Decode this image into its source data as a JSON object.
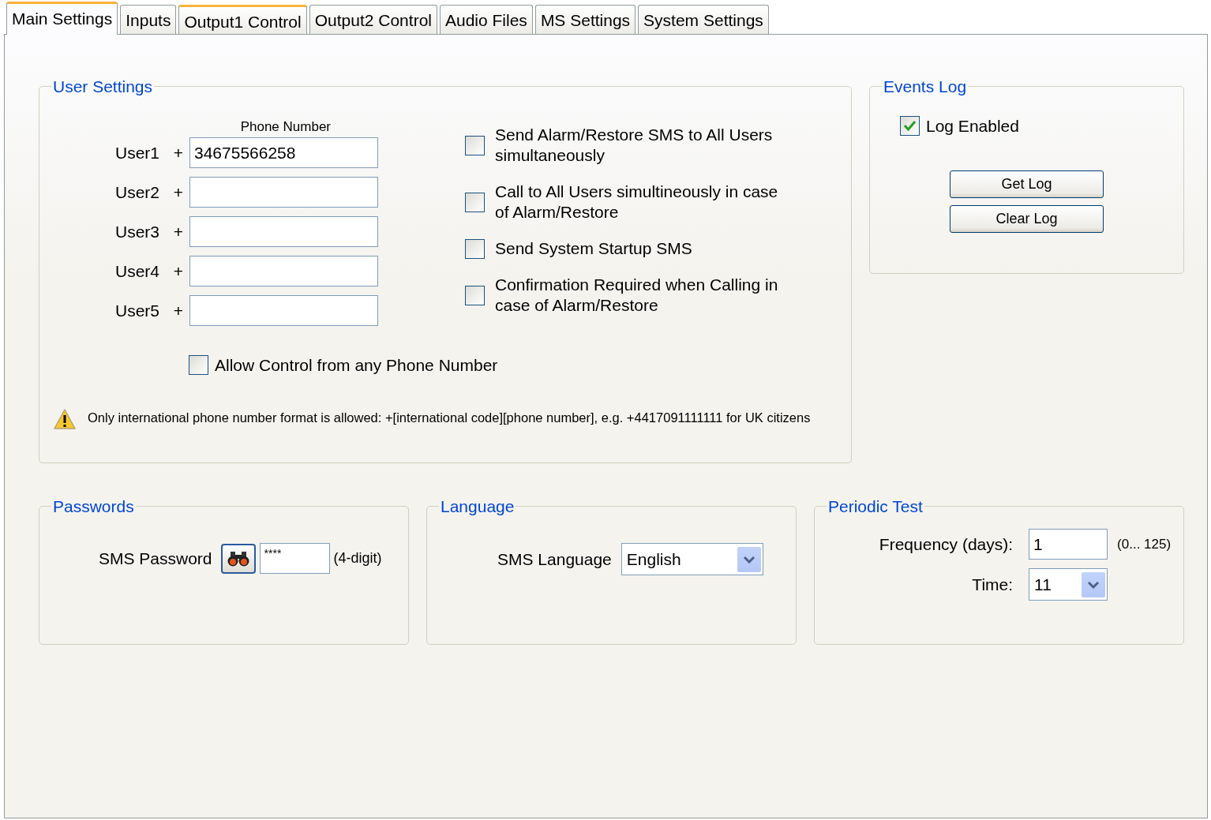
{
  "tabs": [
    {
      "label": "Main Settings",
      "selected": true,
      "hovered": false
    },
    {
      "label": "Inputs",
      "selected": false,
      "hovered": false
    },
    {
      "label": "Output1 Control",
      "selected": false,
      "hovered": true
    },
    {
      "label": "Output2 Control",
      "selected": false,
      "hovered": false
    },
    {
      "label": "Audio Files",
      "selected": false,
      "hovered": false
    },
    {
      "label": "MS Settings",
      "selected": false,
      "hovered": false
    },
    {
      "label": "System Settings",
      "selected": false,
      "hovered": false
    }
  ],
  "user_settings": {
    "title": "User Settings",
    "phone_column_label": "Phone Number",
    "users": [
      {
        "label": "User1",
        "prefix": "+",
        "value": "34675566258"
      },
      {
        "label": "User2",
        "prefix": "+"
      },
      {
        "label": "User3",
        "prefix": "+"
      },
      {
        "label": "User4",
        "prefix": "+"
      },
      {
        "label": "User5",
        "prefix": "+"
      }
    ],
    "options": [
      {
        "label": "Send Alarm/Restore SMS to All Users simultaneously",
        "checked": false
      },
      {
        "label": "Call to All Users simultineously in case of Alarm/Restore",
        "checked": false
      },
      {
        "label": "Send System Startup SMS",
        "checked": false
      },
      {
        "label": "Confirmation Required when Calling in case of Alarm/Restore",
        "checked": false
      }
    ],
    "allow_any": {
      "label": "Allow Control from any Phone Number",
      "checked": false
    },
    "note": "Only international phone number format is allowed: +[international code][phone number], e.g. +4417091111111 for UK citizens"
  },
  "events_log": {
    "title": "Events Log",
    "log_enabled": {
      "label": "Log Enabled",
      "checked": true
    },
    "buttons": [
      "Get Log",
      "Clear Log"
    ]
  },
  "passwords": {
    "title": "Passwords",
    "label": "SMS Password",
    "value": "****",
    "hint": "(4-digit)"
  },
  "language": {
    "title": "Language",
    "label": "SMS Language",
    "value": "English"
  },
  "periodic_test": {
    "title": "Periodic Test",
    "frequency": {
      "label": "Frequency (days):",
      "value": "1",
      "hint": "(0... 125)"
    },
    "time": {
      "label": "Time:",
      "value": "11"
    }
  }
}
